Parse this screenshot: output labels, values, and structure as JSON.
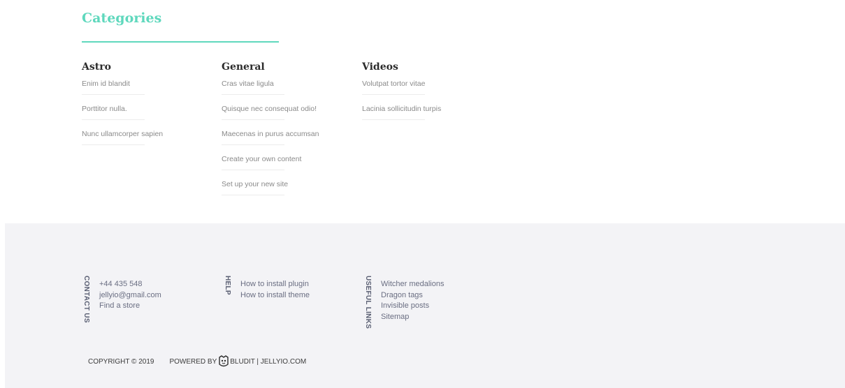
{
  "categories": {
    "title": "Categories",
    "columns": [
      {
        "title": "Astro",
        "links": [
          "Enim id blandit",
          "Porttitor nulla.",
          "Nunc ullamcorper sapien"
        ]
      },
      {
        "title": "General",
        "links": [
          "Cras vitae ligula",
          "Quisque nec consequat odio!",
          "Maecenas in purus accumsan",
          "Create your own content",
          "Set up your new site"
        ]
      },
      {
        "title": "Videos",
        "links": [
          "Volutpat tortor vitae",
          "Lacinia sollicitudin turpis"
        ]
      }
    ]
  },
  "footer": {
    "contact": {
      "label": "CONTACT US",
      "links": [
        "+44 435 548",
        "jellyio@gmail.com",
        "Find a store"
      ]
    },
    "help": {
      "label": "HELP",
      "links": [
        "How to install plugin",
        "How to install theme"
      ]
    },
    "useful": {
      "label": "USEFUL LINKS",
      "links": [
        "Witcher medalions",
        "Dragon tags",
        "Invisible posts",
        "Sitemap"
      ]
    },
    "copyright": "COPYRIGHT © 2019",
    "powered_prefix": "POWERED BY",
    "powered_suffix": "BLUDIT | JELLYIO.COM",
    "icons": {
      "bludit": "bludit-logo-icon"
    }
  },
  "colors": {
    "accent": "#5fd8bd",
    "footer_bg": "#f3f3f6",
    "muted_text": "#8a8a8a"
  }
}
